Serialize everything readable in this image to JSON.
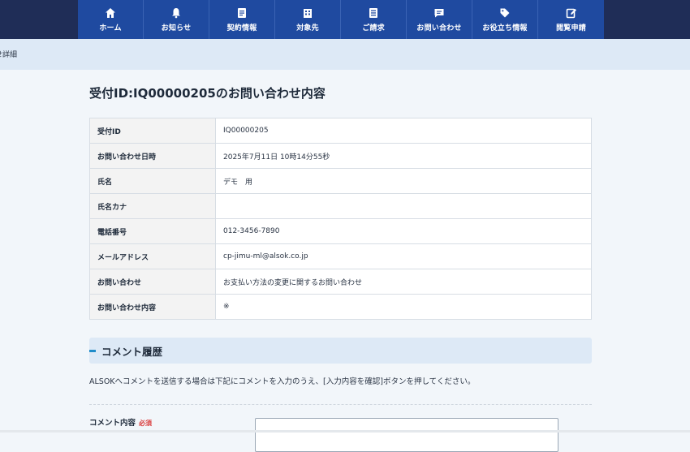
{
  "nav": {
    "items": [
      {
        "label": "ホーム",
        "icon": "home-icon"
      },
      {
        "label": "お知らせ",
        "icon": "bell-icon"
      },
      {
        "label": "契約情報",
        "icon": "contract-icon"
      },
      {
        "label": "対象先",
        "icon": "building-icon"
      },
      {
        "label": "ご請求",
        "icon": "invoice-icon"
      },
      {
        "label": "お問い合わせ",
        "icon": "message-icon"
      },
      {
        "label": "お役立ち情報",
        "icon": "tag-icon"
      },
      {
        "label": "閲覧申請",
        "icon": "edit-icon"
      }
    ]
  },
  "breadcrumb": {
    "current": "せ詳細"
  },
  "page": {
    "title": "受付ID:IQ00000205のお問い合わせ内容"
  },
  "details": [
    {
      "label": "受付ID",
      "value": "IQ00000205"
    },
    {
      "label": "お問い合わせ日時",
      "value": "2025年7月11日 10時14分55秒"
    },
    {
      "label": "氏名",
      "value": "デモ　用"
    },
    {
      "label": "氏名カナ",
      "value": ""
    },
    {
      "label": "電話番号",
      "value": "012-3456-7890"
    },
    {
      "label": "メールアドレス",
      "value": "cp-jimu-ml@alsok.co.jp"
    },
    {
      "label": "お問い合わせ",
      "value": "お支払い方法の変更に関するお問い合わせ"
    },
    {
      "label": "お問い合わせ内容",
      "value": "※"
    }
  ],
  "comments": {
    "title": "コメント履歴",
    "note": "ALSOKへコメントを送信する場合は下記にコメントを入力のうえ、[入力内容を確認]ボタンを押してください。",
    "field_label": "コメント内容",
    "required": "必須"
  },
  "colors": {
    "nav_bg": "#1f4aa0",
    "header_bg": "#1f2d57",
    "accent": "#1f8cc9"
  }
}
